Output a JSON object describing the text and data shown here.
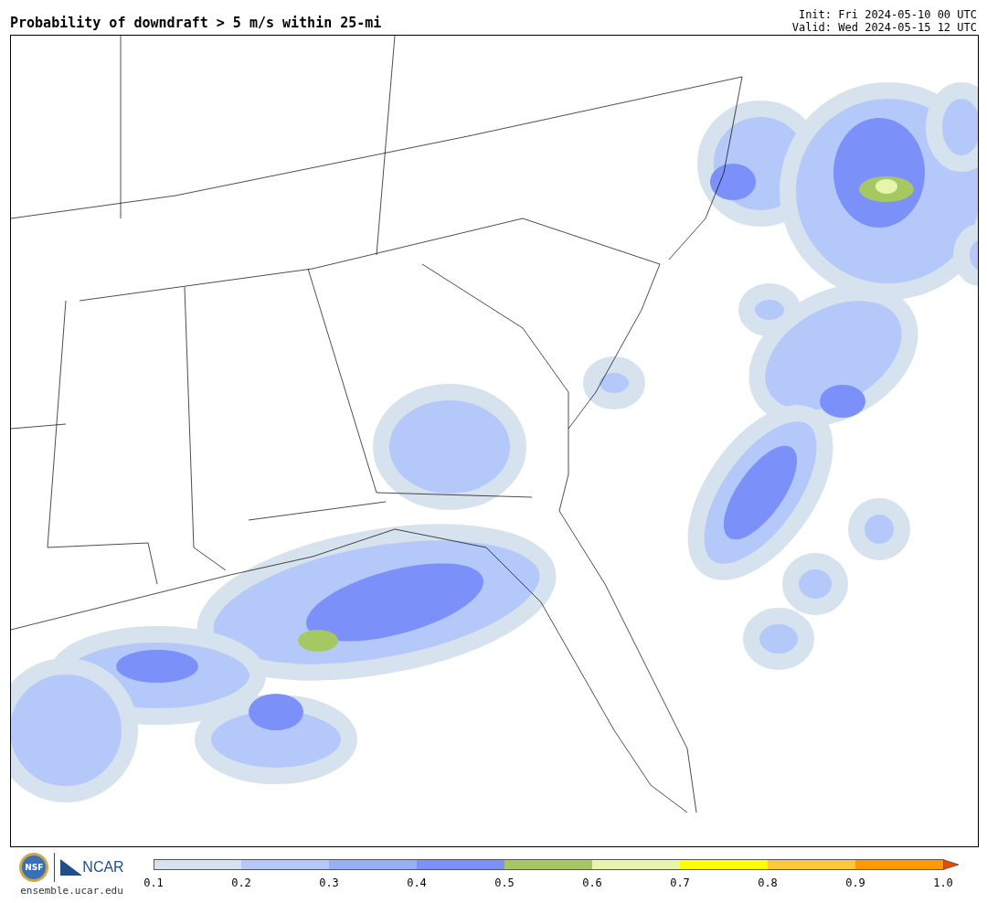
{
  "title": "Probability of downdraft > 5 m/s within 25-mi",
  "init": "Init: Fri 2024-05-10 00 UTC",
  "valid": "Valid: Wed 2024-05-15 12 UTC",
  "logos": {
    "nsf": "NSF",
    "ncar": "NCAR",
    "url": "ensemble.ucar.edu"
  },
  "colorbar": {
    "bins": [
      {
        "color": "#d6e2ed"
      },
      {
        "color": "#b4c8fa"
      },
      {
        "color": "#96b0f8"
      },
      {
        "color": "#7b90f8"
      },
      {
        "color": "#a6c863"
      },
      {
        "color": "#e6f5aa"
      },
      {
        "color": "#ffff00"
      },
      {
        "color": "#ffc83c"
      },
      {
        "color": "#ff9a00"
      },
      {
        "color": "#e64b00",
        "kind": "arrow"
      }
    ],
    "ticks": [
      "0.1",
      "0.2",
      "0.3",
      "0.4",
      "0.5",
      "0.6",
      "0.7",
      "0.8",
      "0.9",
      "1.0"
    ]
  }
}
